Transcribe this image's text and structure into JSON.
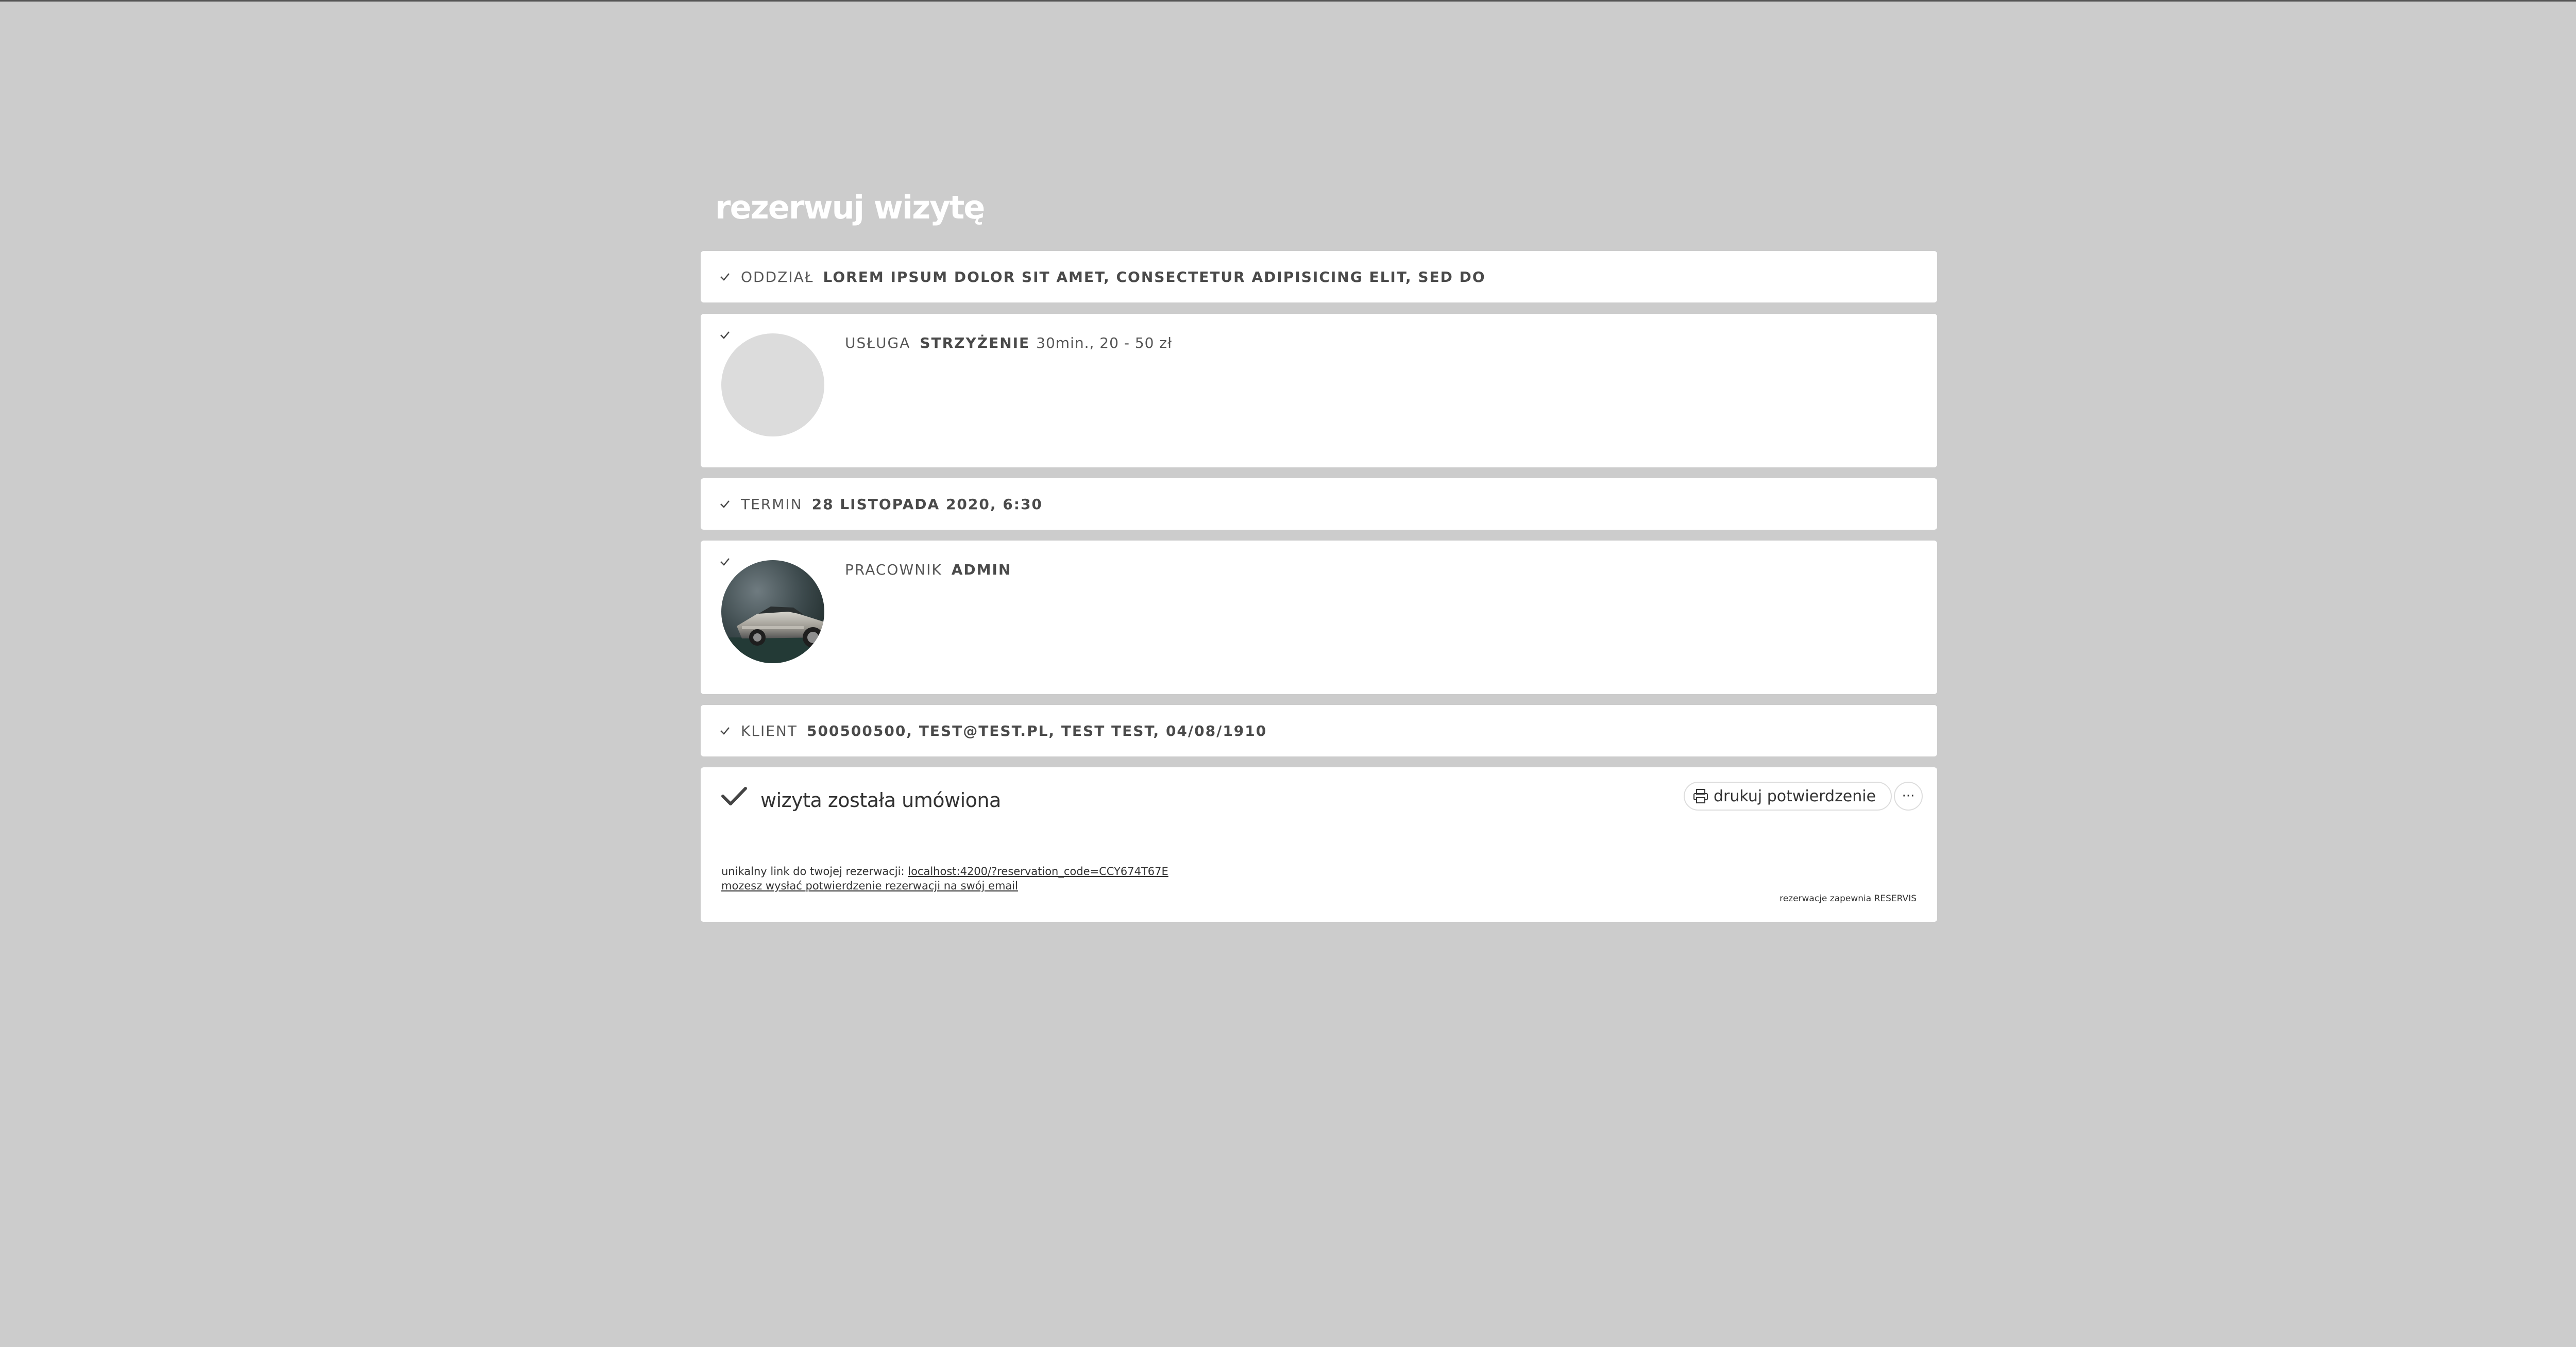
{
  "page": {
    "title": "rezerwuj wizytę"
  },
  "branch": {
    "label": "ODDZIAŁ",
    "value": "LOREM IPSUM DOLOR SIT AMET, CONSECTETUR ADIPISICING ELIT, SED DO"
  },
  "service": {
    "label": "USŁUGA",
    "value": "STRZYŻENIE",
    "details": "30min., 20 - 50 zł"
  },
  "term": {
    "label": "TERMIN",
    "value": "28 LISTOPADA 2020, 6:30"
  },
  "employee": {
    "label": "PRACOWNIK",
    "value": "ADMIN"
  },
  "client": {
    "label": "KLIENT",
    "value": "500500500, TEST@TEST.PL, TEST TEST, 04/08/1910"
  },
  "confirmation": {
    "title": "wizyta została umówiona",
    "print_label": "drukuj potwierdzenie",
    "more_label": "···",
    "link_prefix": "unikalny link do twojej rezerwacji:",
    "link_text": "localhost:4200/?reservation_code=CCY674T67E",
    "email_link": "mozesz wysłać potwierdzenie rezerwacji na swój email",
    "powered_by": "rezerwacje zapewnia RESERVIS"
  },
  "colors": {
    "background": "#cccccc",
    "card": "#ffffff",
    "text": "#444444"
  }
}
